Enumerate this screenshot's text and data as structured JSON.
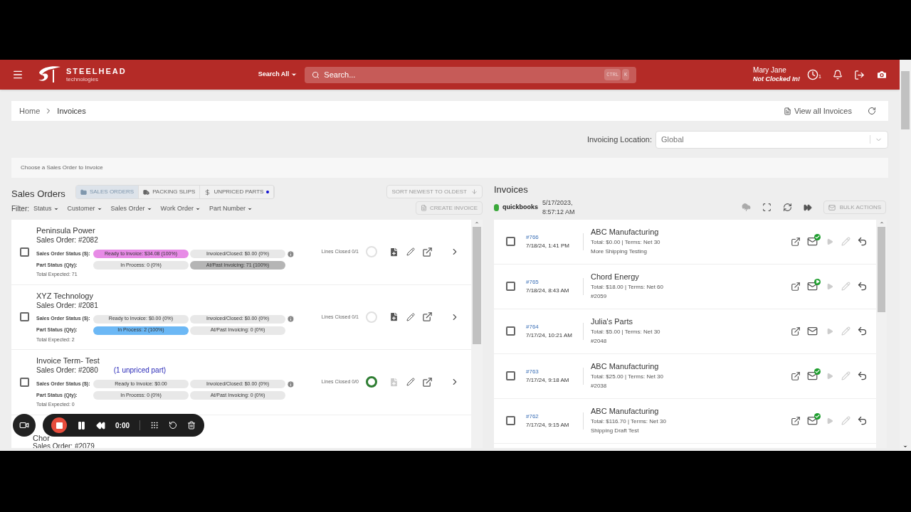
{
  "header": {
    "brand": "STEELHEAD",
    "brand_sub": "technologies",
    "search_scope": "Search All",
    "search_placeholder": "Search...",
    "shortcut": [
      "CTRL",
      "K"
    ],
    "user_name": "Mary Jane",
    "user_status": "Not Clocked In!",
    "clock_badge": "1"
  },
  "breadcrumb": [
    "Home",
    "Invoices"
  ],
  "view_all": "View all Invoices",
  "location": {
    "label": "Invoicing Location:",
    "value": "Global"
  },
  "hint": "Choose a Sales Order to Invoice",
  "sales": {
    "title": "Sales Orders",
    "tabs": [
      {
        "label": "SALES ORDERS",
        "selected": true,
        "alert": false
      },
      {
        "label": "PACKING SLIPS",
        "selected": false,
        "alert": false
      },
      {
        "label": "UNPRICED PARTS",
        "selected": false,
        "alert": true
      }
    ],
    "sort": "SORT NEWEST TO OLDEST",
    "create": "CREATE INVOICE",
    "filter_label": "Filter:",
    "filters": [
      "Status",
      "Customer",
      "Sales Order",
      "Work Order",
      "Part Number"
    ],
    "orders": [
      {
        "name": "Peninsula Power",
        "number": "Sales Order: #2082",
        "checked": false,
        "so_label": "Sales Order Status ($):",
        "part_label": "Part Status (Qty):",
        "pills": [
          {
            "text": "Ready to Invoice: $34.08 (100%)",
            "color": "#e78be6"
          },
          {
            "text": "Invoiced/Closed: $0.00 (0%)",
            "color": "#e8e8e8"
          },
          {
            "text": "In Process: 0 (0%)",
            "color": "#e8e8e8"
          },
          {
            "text": "At/Past Invoicing: 71 (100%)",
            "color": "#b5b5b5"
          }
        ],
        "expected": "Total Expected: 71",
        "lines": "Lines Closed 0/1",
        "done": false,
        "can_invoice": true
      },
      {
        "name": "XYZ Technology",
        "number": "Sales Order: #2081",
        "checked": false,
        "so_label": "Sales Order Status ($):",
        "part_label": "Part Status (Qty):",
        "pills": [
          {
            "text": "Ready to Invoice: $0.00 (0%)",
            "color": "#e8e8e8"
          },
          {
            "text": "Invoiced/Closed: $0.00 (0%)",
            "color": "#e8e8e8"
          },
          {
            "text": "In Process: 2 (100%)",
            "color": "#6cb8f5"
          },
          {
            "text": "At/Past Invoicing: 0 (0%)",
            "color": "#e8e8e8"
          }
        ],
        "expected": "Total Expected: 2",
        "lines": "Lines Closed 0/1",
        "done": false,
        "can_invoice": true
      },
      {
        "name": "Invoice Term- Test",
        "number": "Sales Order: #2080",
        "note": "(1 unpriced part)",
        "checked": false,
        "so_label": "Sales Order Status ($):",
        "part_label": "Part Status (Qty):",
        "pills": [
          {
            "text": "Ready to Invoice: $0.00",
            "color": "#e8e8e8"
          },
          {
            "text": "Invoiced/Closed: $0.00 (0%)",
            "color": "#e8e8e8"
          },
          {
            "text": "In Process: 0 (0%)",
            "color": "#e8e8e8"
          },
          {
            "text": "At/Past Invoicing: 0 (0%)",
            "color": "#e8e8e8"
          }
        ],
        "expected": "Total Expected: 0",
        "lines": "Lines Closed 0/0",
        "done": true,
        "can_invoice": false
      }
    ],
    "partial": {
      "name": "Chor",
      "number": "Sales Order: #2079"
    }
  },
  "invoices": {
    "title": "Invoices",
    "sync_time": [
      "5/17/2023,",
      "8:57:12 AM"
    ],
    "qb": "quickbooks",
    "bulk": "BULK ACTIONS",
    "rows": [
      {
        "id": "#766",
        "date": "7/18/24, 1:41 PM",
        "customer": "ABC Manufacturing",
        "total": "Total: $0.00 | Terms: Net 30",
        "ref": "More Shipping Testing",
        "checked": false,
        "mail_sent": true,
        "mail_queued": false
      },
      {
        "id": "#765",
        "date": "7/18/24, 8:43 AM",
        "customer": "Chord Energy",
        "total": "Total: $18.00 | Terms: Net 60",
        "ref": "#2059",
        "checked": false,
        "mail_sent": false,
        "mail_queued": true
      },
      {
        "id": "#764",
        "date": "7/17/24, 10:21 AM",
        "customer": "Julia's Parts",
        "total": "Total: $5.00 | Terms: Net 30",
        "ref": "#2048",
        "checked": false,
        "mail_sent": false,
        "mail_queued": false
      },
      {
        "id": "#763",
        "date": "7/17/24, 9:18 AM",
        "customer": "ABC Manufacturing",
        "total": "Total: $25.00 | Terms: Net 30",
        "ref": "#2038",
        "checked": false,
        "mail_sent": true,
        "mail_queued": false
      },
      {
        "id": "#762",
        "date": "7/17/24, 9:15 AM",
        "customer": "ABC Manufacturing",
        "total": "Total: $116.70 | Terms: Net 30",
        "ref": "Shipping Draft Test",
        "checked": false,
        "mail_sent": true,
        "mail_queued": false
      }
    ]
  },
  "recorder": {
    "time": "0:00"
  }
}
